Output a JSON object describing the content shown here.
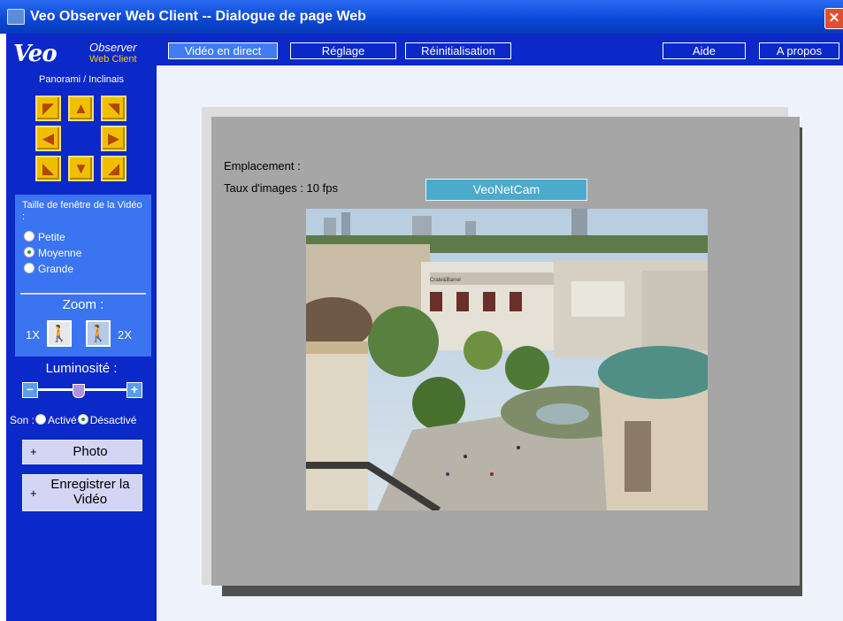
{
  "window": {
    "title": "Veo Observer Web Client -- Dialogue de page Web",
    "close_glyph": "✕"
  },
  "logo": {
    "veo": "Veo",
    "observer": "Observer",
    "web_client": "Web Client"
  },
  "toolbar": {
    "live_video": "Vidéo en direct",
    "settings": "Réglage",
    "reset": "Réinitialisation",
    "help": "Aide",
    "about": "A propos"
  },
  "sidebar": {
    "pan_tilt_label": "Panorami / Inclinais",
    "arrows": {
      "up_left": "◤",
      "up": "▲",
      "up_right": "◥",
      "left": "◀",
      "right": "▶",
      "down_left": "◣",
      "down": "▼",
      "down_right": "◢"
    },
    "video_size": {
      "title": "Taille de fenêtre de la Vidéo :",
      "options": [
        "Petite",
        "Moyenne",
        "Grande"
      ],
      "selected": "Moyenne"
    },
    "zoom": {
      "label": "Zoom :",
      "min": "1X",
      "max": "2X",
      "in_glyph": "🚶",
      "out_glyph": "🚶"
    },
    "brightness": {
      "label": "Luminosité :",
      "minus": "−",
      "plus": "+",
      "level": 0.45
    },
    "sound": {
      "label": "Son :",
      "on": "Activé",
      "off": "Désactivé",
      "selected": "Désactivé"
    },
    "photo_button": {
      "plus": "+",
      "label": "Photo"
    },
    "record_button": {
      "plus": "+",
      "label": "Enregistrer la Vidéo"
    }
  },
  "main": {
    "location_label": "Emplacement :",
    "framerate_label": "Taux d'images : 10 fps",
    "camera_name": "VeoNetCam",
    "store_sign": "Crate&Barrel"
  },
  "colors": {
    "titlebar": "#0a47d6",
    "sidebar": "#0b28c8",
    "panel_box": "#3b74f0",
    "main_bg": "#eef3fb",
    "frame": "#a6a6a6",
    "camera_label": "#4aabcc"
  }
}
